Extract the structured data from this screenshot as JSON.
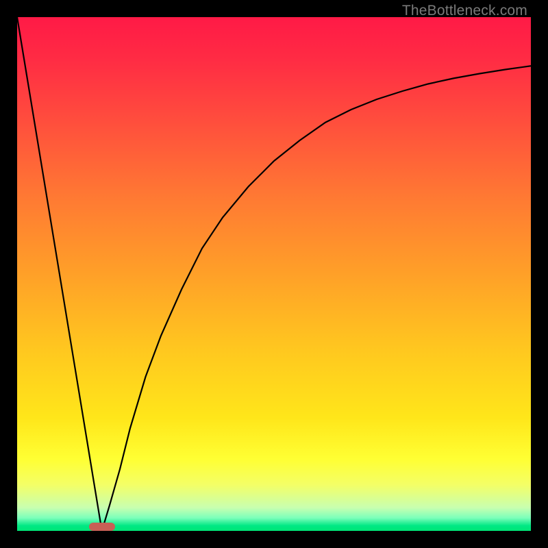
{
  "watermark": "TheBottleneck.com",
  "colors": {
    "frame": "#000000",
    "gradient_stops": [
      {
        "offset": 0.0,
        "color": "#ff1a46"
      },
      {
        "offset": 0.08,
        "color": "#ff2b44"
      },
      {
        "offset": 0.2,
        "color": "#ff4d3d"
      },
      {
        "offset": 0.35,
        "color": "#ff7933"
      },
      {
        "offset": 0.5,
        "color": "#ffa028"
      },
      {
        "offset": 0.65,
        "color": "#ffc81f"
      },
      {
        "offset": 0.78,
        "color": "#ffe61a"
      },
      {
        "offset": 0.86,
        "color": "#ffff33"
      },
      {
        "offset": 0.91,
        "color": "#f4ff66"
      },
      {
        "offset": 0.955,
        "color": "#c8ffb0"
      },
      {
        "offset": 0.975,
        "color": "#7affba"
      },
      {
        "offset": 0.99,
        "color": "#00e884"
      },
      {
        "offset": 1.0,
        "color": "#00e676"
      }
    ],
    "curve": "#000000",
    "marker": "#c86055"
  },
  "chart_data": {
    "type": "line",
    "title": "",
    "xlabel": "",
    "ylabel": "",
    "xlim": [
      0,
      100
    ],
    "ylim": [
      0,
      100
    ],
    "grid": false,
    "series": [
      {
        "name": "left-line",
        "x": [
          0.0,
          16.5
        ],
        "y": [
          100.0,
          0.0
        ]
      },
      {
        "name": "right-curve",
        "x": [
          16.5,
          18,
          20,
          22,
          25,
          28,
          32,
          36,
          40,
          45,
          50,
          55,
          60,
          65,
          70,
          75,
          80,
          85,
          90,
          95,
          100
        ],
        "y": [
          0.0,
          5,
          12,
          20,
          30,
          38,
          47,
          55,
          61,
          67,
          72,
          76,
          79.5,
          82,
          84,
          85.6,
          87,
          88.1,
          89,
          89.8,
          90.5
        ]
      }
    ],
    "annotations": [
      {
        "name": "ideal-marker",
        "x_range": [
          14.0,
          19.0
        ],
        "y": 0.0
      }
    ]
  }
}
